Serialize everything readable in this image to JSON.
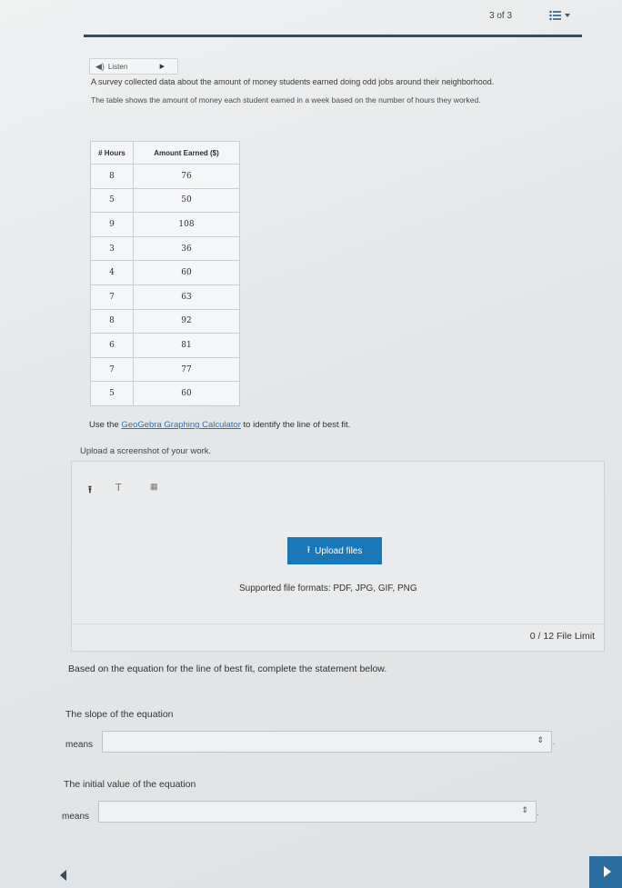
{
  "header": {
    "page_counter": "3 of 3"
  },
  "listen": {
    "label": "Listen",
    "play_icon": "play-icon"
  },
  "intro": "A survey collected data about the amount of money students earned doing odd jobs around their neighborhood.",
  "description": "The table shows the amount of money each student earned in a week based on the number of hours they worked.",
  "table": {
    "headers": [
      "# Hours",
      "Amount Earned ($)"
    ],
    "rows": [
      [
        "8",
        "76"
      ],
      [
        "5",
        "50"
      ],
      [
        "9",
        "108"
      ],
      [
        "3",
        "36"
      ],
      [
        "4",
        "60"
      ],
      [
        "7",
        "63"
      ],
      [
        "8",
        "92"
      ],
      [
        "6",
        "81"
      ],
      [
        "7",
        "77"
      ],
      [
        "5",
        "60"
      ]
    ]
  },
  "instruction": {
    "prefix": "Use the ",
    "link": "GeoGebra Graphing Calculator",
    "suffix": " to identify the line of best fit."
  },
  "upload": {
    "prompt": "Upload a screenshot of your work.",
    "button": "Upload files",
    "formats": "Supported file formats: PDF, JPG, GIF, PNG",
    "limit": "0 / 12 File Limit"
  },
  "statement": "Based on the equation for the line of best fit, complete the statement below.",
  "question1": {
    "text": "The slope of the equation",
    "means": "means",
    "value": ""
  },
  "question2": {
    "text": "The initial value of the equation",
    "means": "means",
    "value": ""
  },
  "colors": {
    "accent": "#1a78b8",
    "rule": "#3b4a57",
    "next_button": "#2b6d9e"
  }
}
